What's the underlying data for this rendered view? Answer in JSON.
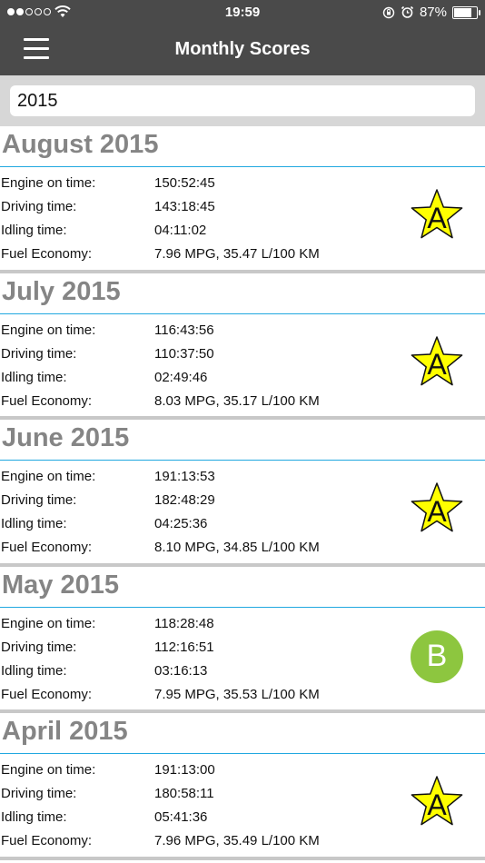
{
  "status": {
    "time": "19:59",
    "battery": "87%",
    "battery_level": 0.87
  },
  "nav": {
    "title": "Monthly Scores"
  },
  "search": {
    "value": "2015"
  },
  "labels": {
    "engine": "Engine on time:",
    "driving": "Driving time:",
    "idling": "Idling time:",
    "fuel": "Fuel Economy:"
  },
  "months": [
    {
      "title": "August 2015",
      "engine": "150:52:45",
      "driving": "143:18:45",
      "idling": "04:11:02",
      "fuel": "7.96 MPG, 35.47 L/100 KM",
      "grade": "A",
      "badge": "star-icon"
    },
    {
      "title": "July 2015",
      "engine": "116:43:56",
      "driving": "110:37:50",
      "idling": "02:49:46",
      "fuel": "8.03 MPG, 35.17 L/100 KM",
      "grade": "A",
      "badge": "star-icon"
    },
    {
      "title": "June 2015",
      "engine": "191:13:53",
      "driving": "182:48:29",
      "idling": "04:25:36",
      "fuel": "8.10 MPG, 34.85 L/100 KM",
      "grade": "A",
      "badge": "star-icon"
    },
    {
      "title": "May 2015",
      "engine": "118:28:48",
      "driving": "112:16:51",
      "idling": "03:16:13",
      "fuel": "7.95 MPG, 35.53 L/100 KM",
      "grade": "B",
      "badge": "circle-icon"
    },
    {
      "title": "April 2015",
      "engine": "191:13:00",
      "driving": "180:58:11",
      "idling": "05:41:36",
      "fuel": "7.96 MPG, 35.49 L/100 KM",
      "grade": "A",
      "badge": "star-icon"
    }
  ],
  "colors": {
    "bar": "#4a4a4a",
    "accent_line": "#21a8e0",
    "star_fill": "#ffff00",
    "grade_b": "#8dc63f",
    "month_title": "#858585"
  }
}
